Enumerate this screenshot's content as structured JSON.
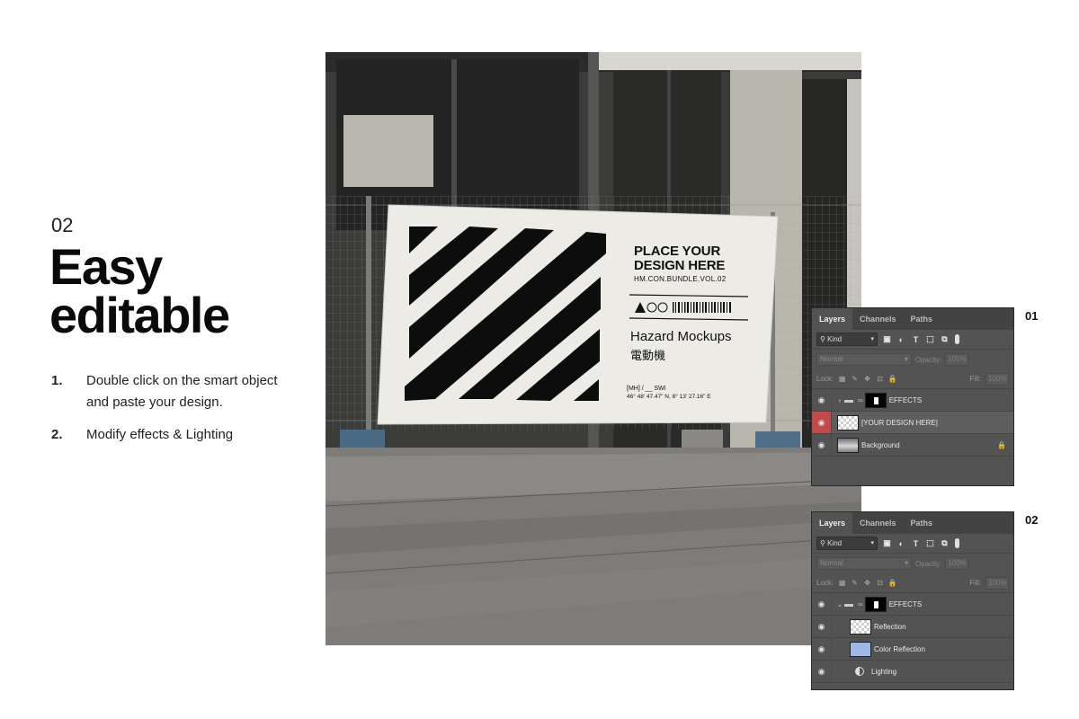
{
  "step": {
    "number": "02",
    "title_line1": "Easy",
    "title_line2": "editable"
  },
  "instructions": [
    {
      "num": "1.",
      "text": "Double click on the smart object and paste your design."
    },
    {
      "num": "2.",
      "text": "Modify effects & Lighting"
    }
  ],
  "banner": {
    "headline_line1": "PLACE YOUR",
    "headline_line2": "DESIGN HERE",
    "code": "HM.CON.BUNDLE.VOL.02",
    "brand": "Hazard Mockups",
    "brand_jp": "電動機",
    "ref": "[MH] / __ SWI",
    "coords": "46° 48' 47.47\" N, 8° 13' 27.16\" E"
  },
  "panels": [
    {
      "tag": "01",
      "tabs": [
        "Layers",
        "Channels",
        "Paths"
      ],
      "kind_label": "Kind",
      "blend_mode": "Normal",
      "opacity_label": "Opacity:",
      "opacity_value": "100%",
      "lock_label": "Lock:",
      "fill_label": "Fill:",
      "fill_value": "100%",
      "layers": [
        {
          "name": "EFFECTS",
          "type": "group-collapsed"
        },
        {
          "name": "[YOUR DESIGN HERE]",
          "type": "smart-selected"
        },
        {
          "name": "Background",
          "type": "background-locked"
        }
      ]
    },
    {
      "tag": "02",
      "tabs": [
        "Layers",
        "Channels",
        "Paths"
      ],
      "kind_label": "Kind",
      "blend_mode": "Normal",
      "opacity_label": "Opacity:",
      "opacity_value": "100%",
      "lock_label": "Lock:",
      "fill_label": "Fill:",
      "fill_value": "100%",
      "layers": [
        {
          "name": "EFFECTS",
          "type": "group-expanded"
        },
        {
          "name": "Reflection",
          "type": "child-checker"
        },
        {
          "name": "Color Reflection",
          "type": "child-blue"
        },
        {
          "name": "Lighting",
          "type": "child-adjustment"
        }
      ]
    }
  ],
  "colors": {
    "panel_bg": "#535353",
    "selected_eye": "#c14b4b",
    "color_reflection_thumb": "#9db8e6"
  }
}
